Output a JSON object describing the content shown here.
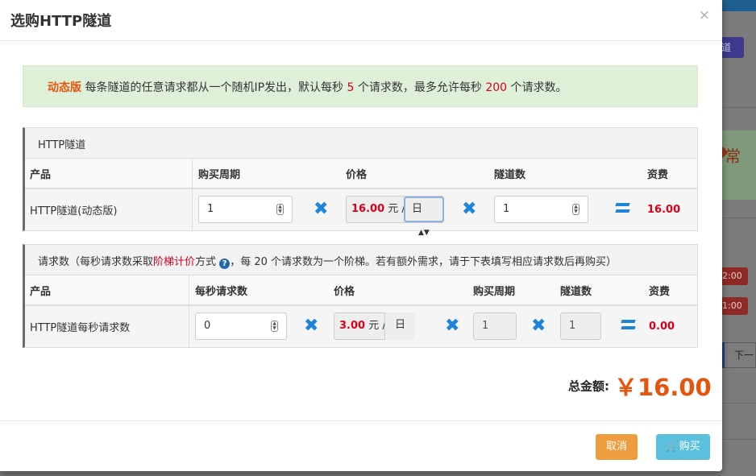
{
  "modal": {
    "title": "选购HTTP隧道",
    "close": "×"
  },
  "alert": {
    "edition": "动态版",
    "text1": " 每条隧道的任意请求都从一个随机IP发出，默认每秒 ",
    "default_rate": "5",
    "text2": " 个请求数，最多允许每秒 ",
    "max_rate": "200",
    "text3": " 个请求数。"
  },
  "tunnel_panel": {
    "title": "HTTP隧道",
    "headers": {
      "product": "产品",
      "period": "购买周期",
      "price": "价格",
      "count": "隧道数",
      "fee": "资费"
    },
    "row": {
      "product": "HTTP隧道(动态版)",
      "period": "1",
      "price": "16.00",
      "price_unit": "元 /",
      "period_unit": "日",
      "count": "1",
      "fee": "16.00"
    }
  },
  "request_panel": {
    "title_pre": "请求数（每秒请求数采取",
    "title_link": "阶梯计价",
    "title_mid": "方式",
    "title_post": "，每 20 个请求数为一个阶梯。若有额外需求，请于下表填写相应请求数后再购买）",
    "headers": {
      "product": "产品",
      "rate": "每秒请求数",
      "price": "价格",
      "period": "购买周期",
      "count": "隧道数",
      "fee": "资费"
    },
    "row": {
      "product": "HTTP隧道每秒请求数",
      "rate": "0",
      "price": "3.00",
      "price_unit": "元 /",
      "period_unit": "日",
      "period": "1",
      "count": "1",
      "fee": "0.00"
    }
  },
  "total": {
    "label": "总金额:",
    "amount": "￥16.00"
  },
  "footer": {
    "cancel": "取消",
    "buy": "购买"
  },
  "background": {
    "btn": "道",
    "banner": "常",
    "badge1": "2:00",
    "badge2": "1:00",
    "next": "下一"
  },
  "colors": {
    "accent_orange": "#e6550d",
    "price_red": "#d9001b",
    "icon_blue": "#1e84d9",
    "alert_bg": "#dff0d8",
    "cancel_btn": "#ed9d3d",
    "buy_btn": "#5bc0de"
  }
}
